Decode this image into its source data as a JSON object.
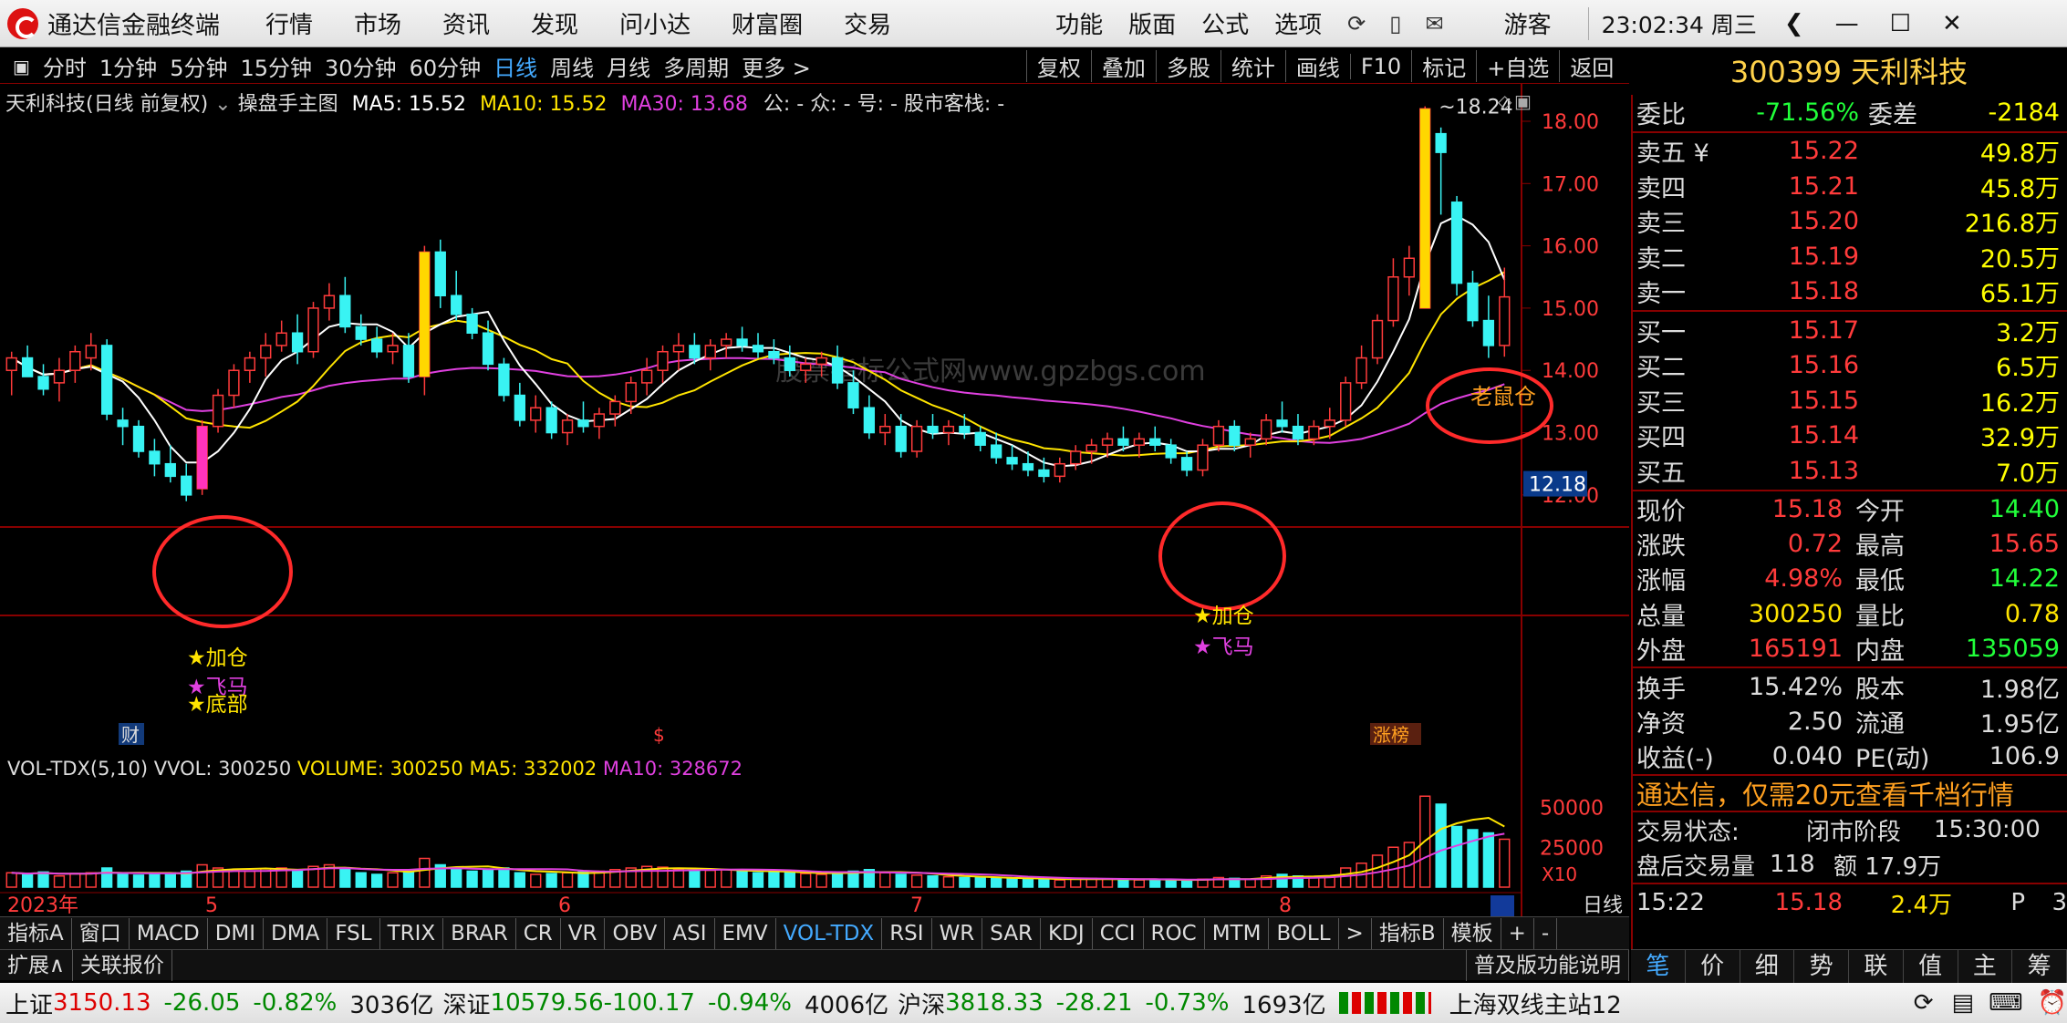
{
  "titlebar": {
    "app": "通达信金融终端",
    "menus": [
      "行情",
      "市场",
      "资讯",
      "发现",
      "问小达",
      "财富圈",
      "交易"
    ],
    "right_menus": [
      "功能",
      "版面",
      "公式",
      "选项"
    ],
    "user": "游客",
    "clock": "23:02:34 周三"
  },
  "periods": [
    "分时",
    "1分钟",
    "5分钟",
    "15分钟",
    "30分钟",
    "60分钟",
    "日线",
    "周线",
    "月线",
    "多周期",
    "更多 >"
  ],
  "selected_period": "日线",
  "toolbar_right": [
    "复权",
    "叠加",
    "多股",
    "统计",
    "画线",
    "F10",
    "标记",
    "+自选",
    "返回"
  ],
  "stock": {
    "code": "300399",
    "name": "天利科技"
  },
  "chart": {
    "title": "天利科技(日线 前复权)",
    "indicator": "操盘手主图",
    "ma5": "MA5: 15.52",
    "ma10": "MA10: 15.52",
    "ma30": "MA30: 13.68",
    "extra": "公: -  众: -  号: -  股市客栈: -",
    "price_axis": [
      "18.00",
      "17.00",
      "16.00",
      "15.00",
      "14.00",
      "13.00",
      "12.00"
    ],
    "current_price_tag": "12.18",
    "peak_label": "18.24",
    "annotations": [
      "★加仓",
      "★飞马",
      "★底部",
      "★加仓",
      "★飞马",
      "老鼠仓"
    ],
    "markers": [
      "财",
      "$",
      "涨榜"
    ],
    "watermark": "股票指标公式网www.gpzbgs.com",
    "vol_info": {
      "name": "VOL-TDX(5,10)",
      "vvol": "VVOL: 300250",
      "volume": "VOLUME: 300250",
      "ma5": "MA5: 332002",
      "ma10": "MA10: 328672"
    },
    "vol_axis": [
      "50000",
      "25000"
    ],
    "vol_unit": "X10",
    "months": [
      "2023年",
      "5",
      "6",
      "7",
      "8"
    ],
    "period_label": "日线"
  },
  "chart_data": {
    "type": "candlestick",
    "title": "天利科技(日线 前复权)",
    "ylim": [
      11.3,
      18.4
    ],
    "candles": [
      [
        14.0,
        14.3,
        13.6,
        14.2
      ],
      [
        14.2,
        14.4,
        13.9,
        13.9
      ],
      [
        13.9,
        14.1,
        13.6,
        13.7
      ],
      [
        13.8,
        14.2,
        13.5,
        14.0
      ],
      [
        14.0,
        14.4,
        13.8,
        14.3
      ],
      [
        14.2,
        14.6,
        14.0,
        14.4
      ],
      [
        14.4,
        14.5,
        13.2,
        13.3
      ],
      [
        13.2,
        13.4,
        12.8,
        13.1
      ],
      [
        13.1,
        13.2,
        12.6,
        12.7
      ],
      [
        12.7,
        12.9,
        12.3,
        12.5
      ],
      [
        12.5,
        12.8,
        12.2,
        12.3
      ],
      [
        12.3,
        12.5,
        11.9,
        12.0
      ],
      [
        12.1,
        13.2,
        12.0,
        13.1
      ],
      [
        13.1,
        13.7,
        13.0,
        13.6
      ],
      [
        13.6,
        14.1,
        13.4,
        14.0
      ],
      [
        14.0,
        14.3,
        13.8,
        14.2
      ],
      [
        14.2,
        14.6,
        13.9,
        14.4
      ],
      [
        14.4,
        14.8,
        14.3,
        14.6
      ],
      [
        14.6,
        14.9,
        14.1,
        14.3
      ],
      [
        14.3,
        15.1,
        14.2,
        15.0
      ],
      [
        15.0,
        15.4,
        14.8,
        15.2
      ],
      [
        15.2,
        15.5,
        14.6,
        14.7
      ],
      [
        14.7,
        14.9,
        14.4,
        14.5
      ],
      [
        14.5,
        14.7,
        14.2,
        14.3
      ],
      [
        14.3,
        14.6,
        14.1,
        14.4
      ],
      [
        14.4,
        14.6,
        13.8,
        13.9
      ],
      [
        13.9,
        16.0,
        13.6,
        15.9
      ],
      [
        15.9,
        16.1,
        15.0,
        15.2
      ],
      [
        15.2,
        15.6,
        14.8,
        14.9
      ],
      [
        14.9,
        15.0,
        14.5,
        14.6
      ],
      [
        14.6,
        14.8,
        14.0,
        14.1
      ],
      [
        14.1,
        14.2,
        13.5,
        13.6
      ],
      [
        13.6,
        13.8,
        13.1,
        13.2
      ],
      [
        13.2,
        13.6,
        13.0,
        13.4
      ],
      [
        13.4,
        13.5,
        12.9,
        13.0
      ],
      [
        13.0,
        13.3,
        12.8,
        13.2
      ],
      [
        13.2,
        13.5,
        13.0,
        13.1
      ],
      [
        13.1,
        13.4,
        12.9,
        13.3
      ],
      [
        13.3,
        13.6,
        13.1,
        13.5
      ],
      [
        13.5,
        13.9,
        13.3,
        13.8
      ],
      [
        13.8,
        14.2,
        13.6,
        14.0
      ],
      [
        14.0,
        14.4,
        13.8,
        14.3
      ],
      [
        14.3,
        14.6,
        14.0,
        14.4
      ],
      [
        14.4,
        14.6,
        14.1,
        14.2
      ],
      [
        14.2,
        14.5,
        14.0,
        14.4
      ],
      [
        14.4,
        14.6,
        14.2,
        14.5
      ],
      [
        14.5,
        14.7,
        14.3,
        14.4
      ],
      [
        14.4,
        14.6,
        14.2,
        14.3
      ],
      [
        14.3,
        14.5,
        14.1,
        14.2
      ],
      [
        14.2,
        14.4,
        13.9,
        14.0
      ],
      [
        14.0,
        14.2,
        13.8,
        14.1
      ],
      [
        14.1,
        14.3,
        13.9,
        14.2
      ],
      [
        14.2,
        14.4,
        13.7,
        13.8
      ],
      [
        13.8,
        14.0,
        13.3,
        13.4
      ],
      [
        13.4,
        13.6,
        12.9,
        13.0
      ],
      [
        13.0,
        13.3,
        12.8,
        13.1
      ],
      [
        13.1,
        13.3,
        12.6,
        12.7
      ],
      [
        12.7,
        13.2,
        12.6,
        13.1
      ],
      [
        13.1,
        13.3,
        12.9,
        13.0
      ],
      [
        13.0,
        13.2,
        12.8,
        13.1
      ],
      [
        13.1,
        13.3,
        12.9,
        13.0
      ],
      [
        13.0,
        13.1,
        12.7,
        12.8
      ],
      [
        12.8,
        13.0,
        12.5,
        12.6
      ],
      [
        12.6,
        12.8,
        12.4,
        12.5
      ],
      [
        12.5,
        12.7,
        12.3,
        12.4
      ],
      [
        12.4,
        12.6,
        12.2,
        12.3
      ],
      [
        12.3,
        12.6,
        12.2,
        12.5
      ],
      [
        12.5,
        12.8,
        12.4,
        12.7
      ],
      [
        12.7,
        12.9,
        12.5,
        12.8
      ],
      [
        12.8,
        13.0,
        12.6,
        12.9
      ],
      [
        12.9,
        13.1,
        12.7,
        12.8
      ],
      [
        12.8,
        13.0,
        12.6,
        12.9
      ],
      [
        12.9,
        13.1,
        12.7,
        12.8
      ],
      [
        12.8,
        12.9,
        12.5,
        12.6
      ],
      [
        12.6,
        12.7,
        12.3,
        12.4
      ],
      [
        12.4,
        12.9,
        12.3,
        12.8
      ],
      [
        12.8,
        13.2,
        12.7,
        13.1
      ],
      [
        13.1,
        13.2,
        12.7,
        12.8
      ],
      [
        12.8,
        13.0,
        12.6,
        12.9
      ],
      [
        12.9,
        13.3,
        12.8,
        13.2
      ],
      [
        13.2,
        13.5,
        13.0,
        13.1
      ],
      [
        13.1,
        13.3,
        12.8,
        12.9
      ],
      [
        12.9,
        13.2,
        12.8,
        13.1
      ],
      [
        13.1,
        13.4,
        12.9,
        13.2
      ],
      [
        13.2,
        13.9,
        13.1,
        13.8
      ],
      [
        13.8,
        14.4,
        13.7,
        14.2
      ],
      [
        14.2,
        14.9,
        14.1,
        14.8
      ],
      [
        14.8,
        15.8,
        14.7,
        15.5
      ],
      [
        15.5,
        16.0,
        15.2,
        15.8
      ],
      [
        15.0,
        18.24,
        15.0,
        18.2
      ],
      [
        17.8,
        17.9,
        16.5,
        17.5
      ],
      [
        16.7,
        16.8,
        15.2,
        15.4
      ],
      [
        15.4,
        15.6,
        14.7,
        14.8
      ],
      [
        14.8,
        15.2,
        14.2,
        14.4
      ],
      [
        14.4,
        15.65,
        14.22,
        15.18
      ]
    ],
    "volume": [
      9000,
      8000,
      9500,
      7000,
      8500,
      9000,
      12000,
      8000,
      7500,
      8000,
      9000,
      10000,
      14000,
      12000,
      11000,
      10000,
      11500,
      12000,
      10000,
      13000,
      14000,
      12000,
      9000,
      8000,
      9000,
      10000,
      18000,
      14000,
      12000,
      10000,
      11000,
      12000,
      9000,
      8000,
      8500,
      9000,
      9500,
      10000,
      11000,
      12000,
      13000,
      12500,
      11000,
      10000,
      10500,
      11000,
      10000,
      9000,
      9500,
      9000,
      8500,
      8000,
      9000,
      10000,
      11000,
      9000,
      8000,
      7500,
      7000,
      6500,
      6000,
      6000,
      5500,
      5000,
      5500,
      5000,
      4500,
      5000,
      5500,
      5000,
      4500,
      4500,
      5000,
      4500,
      4000,
      5000,
      6000,
      5500,
      5000,
      7000,
      8000,
      7000,
      6500,
      7000,
      12000,
      15000,
      20000,
      25000,
      28000,
      57000,
      52000,
      38000,
      36000,
      34000,
      30025
    ],
    "series": [
      {
        "name": "MA5",
        "value": 15.52
      },
      {
        "name": "MA10",
        "value": 15.52
      },
      {
        "name": "MA30",
        "value": 13.68
      }
    ]
  },
  "quote": {
    "wb_label": "委比",
    "wb_val": "-71.56%",
    "wc_label": "委差",
    "wc_val": "-2184",
    "asks": [
      {
        "label": "卖五 ¥",
        "price": "15.22",
        "vol": "49.8万"
      },
      {
        "label": "卖四",
        "price": "15.21",
        "vol": "45.8万"
      },
      {
        "label": "卖三",
        "price": "15.20",
        "vol": "216.8万"
      },
      {
        "label": "卖二",
        "price": "15.19",
        "vol": "20.5万"
      },
      {
        "label": "卖一",
        "price": "15.18",
        "vol": "65.1万"
      }
    ],
    "bids": [
      {
        "label": "买一",
        "price": "15.17",
        "vol": "3.2万"
      },
      {
        "label": "买二",
        "price": "15.16",
        "vol": "6.5万"
      },
      {
        "label": "买三",
        "price": "15.15",
        "vol": "16.2万"
      },
      {
        "label": "买四",
        "price": "15.14",
        "vol": "32.9万"
      },
      {
        "label": "买五",
        "price": "15.13",
        "vol": "7.0万"
      }
    ],
    "stats": [
      {
        "a": "现价",
        "b": "15.18",
        "bc": "red",
        "c": "今开",
        "d": "14.40",
        "dc": "grn"
      },
      {
        "a": "涨跌",
        "b": "0.72",
        "bc": "red",
        "c": "最高",
        "d": "15.65",
        "dc": "red"
      },
      {
        "a": "涨幅",
        "b": "4.98%",
        "bc": "red",
        "c": "最低",
        "d": "14.22",
        "dc": "grn"
      },
      {
        "a": "总量",
        "b": "300250",
        "bc": "yel",
        "c": "量比",
        "d": "0.78",
        "dc": "yel"
      },
      {
        "a": "外盘",
        "b": "165191",
        "bc": "red",
        "c": "内盘",
        "d": "135059",
        "dc": "grn"
      }
    ],
    "stats2": [
      {
        "a": "换手",
        "b": "15.42%",
        "c": "股本",
        "d": "1.98亿"
      },
      {
        "a": "净资",
        "b": "2.50",
        "c": "流通",
        "d": "1.95亿"
      },
      {
        "a": "收益(-)",
        "b": "0.040",
        "c": "PE(动)",
        "d": "106.9"
      }
    ],
    "ad": "通达信，仅需20元查看千档行情",
    "status": [
      {
        "a": "交易状态:",
        "b": "闭市阶段",
        "c": "15:30:00"
      },
      {
        "a": "盘后交易量",
        "b": "118",
        "c": "额 17.9万"
      }
    ],
    "tick": {
      "time": "15:22",
      "price": "15.18",
      "vol": "2.4万",
      "flag": "P",
      "n": "3"
    }
  },
  "indicator_tabs": [
    "指标A",
    "窗口",
    "MACD",
    "DMI",
    "DMA",
    "FSL",
    "TRIX",
    "BRAR",
    "CR",
    "VR",
    "OBV",
    "ASI",
    "EMV",
    "VOL-TDX",
    "RSI",
    "WR",
    "SAR",
    "KDJ",
    "CCI",
    "ROC",
    "MTM",
    "BOLL",
    ">",
    "指标B",
    "模板",
    "+",
    "-"
  ],
  "selected_tab": "VOL-TDX",
  "ext": {
    "expand": "扩展∧",
    "link": "关联报价",
    "help": "普及版功能说明"
  },
  "rtabs": [
    "笔",
    "价",
    "细",
    "势",
    "联",
    "值",
    "主",
    "筹"
  ],
  "indexbar": {
    "sh": "上证",
    "sh_v": "3150.13",
    "sh_c": "-26.05",
    "sh_p": "-0.82%",
    "sh_a": "3036亿",
    "sz": "深证",
    "sz_v": "10579.56",
    "sz_c": "-100.17",
    "sz_p": "-0.94%",
    "sz_a": "4006亿",
    "hs": "沪深",
    "hs_v": "3818.33",
    "hs_c": "-28.21",
    "hs_p": "-0.73%",
    "hs_a": "1693亿",
    "server": "上海双线主站12"
  },
  "colors": {
    "up": "#ff3b3b",
    "down": "#39f3f3",
    "ma5": "#ffffff",
    "ma10": "#ffe400",
    "ma30": "#e040e0",
    "border": "#880000",
    "circle": "#ff2a2a"
  }
}
